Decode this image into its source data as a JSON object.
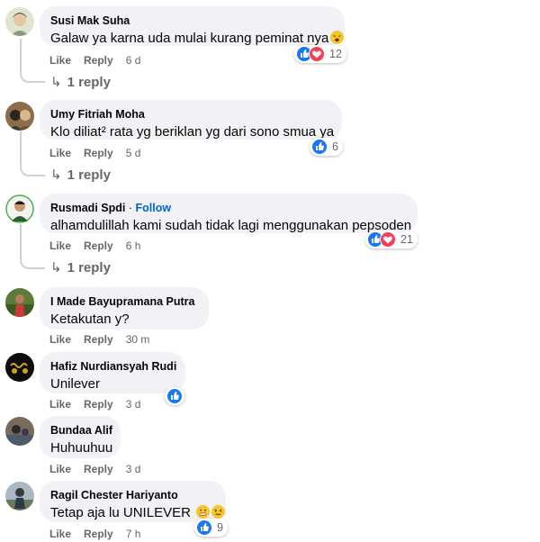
{
  "action_labels": {
    "like": "Like",
    "reply": "Reply"
  },
  "comments": [
    {
      "author": "Susi Mak Suha",
      "text": "Galaw ya karna uda mulai kurang peminat nya",
      "time": "6 d",
      "reaction_count": "12",
      "reactions": [
        "like-icon",
        "love-icon"
      ],
      "replies": "1 reply"
    },
    {
      "author": "Umy Fitriah Moha",
      "text": "Klo diliat² rata yg beriklan yg dari sono smua ya",
      "time": "5 d",
      "reaction_count": "6",
      "reactions": [
        "like-icon"
      ],
      "replies": "1 reply"
    },
    {
      "author": "Rusmadi Spdi",
      "follow": "Follow",
      "separator": "·",
      "text": "alhamdulillah kami sudah tidak lagi menggunakan pepsoden",
      "time": "6 h",
      "reaction_count": "21",
      "reactions": [
        "like-icon",
        "love-icon"
      ],
      "replies": "1 reply"
    },
    {
      "author": "I Made Bayupramana Putra",
      "text": "Ketakutan y?",
      "time": "30 m"
    },
    {
      "author": "Hafiz Nurdiansyah Rudi",
      "text": "Unilever",
      "time": "3 d",
      "reactions": [
        "like-icon"
      ]
    },
    {
      "author": "Bundaa Alif",
      "text": "Huhuuhuu",
      "time": "3 d"
    },
    {
      "author": "Ragil Chester Hariyanto",
      "text": "Tetap aja lu UNILEVER",
      "time": "7 h",
      "reaction_count": "9",
      "reactions": [
        "like-icon"
      ]
    }
  ],
  "colors": {
    "accent": "#1877f2",
    "love": "#f33e58",
    "bubble": "#f0f2f5",
    "muted": "#65676b",
    "follow": "#0064d1"
  }
}
